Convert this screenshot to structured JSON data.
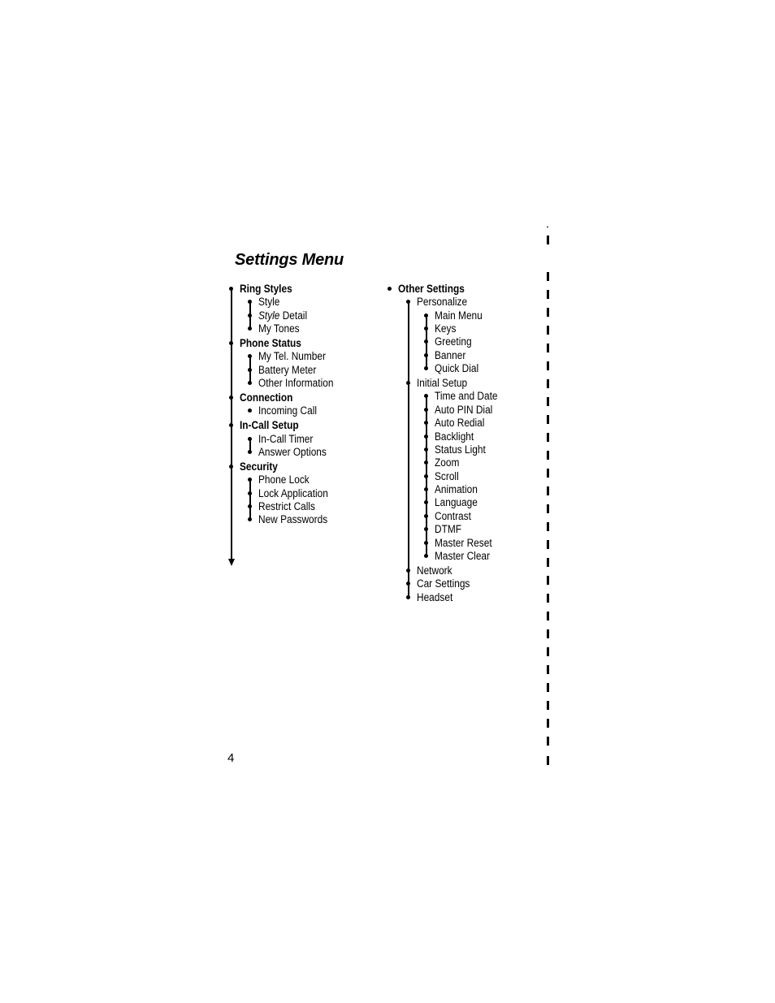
{
  "page": {
    "title": "Settings Menu",
    "page_number": "4"
  },
  "left_column": [
    {
      "label": "Ring Styles",
      "children": [
        {
          "label": "Style"
        },
        {
          "label_italic": "Style",
          "label_rest": " Detail"
        },
        {
          "label": "My Tones"
        }
      ]
    },
    {
      "label": "Phone Status",
      "children": [
        {
          "label": "My Tel. Number"
        },
        {
          "label": "Battery Meter"
        },
        {
          "label": "Other Information"
        }
      ]
    },
    {
      "label": "Connection",
      "children": [
        {
          "label": "Incoming Call"
        }
      ]
    },
    {
      "label": "In-Call Setup",
      "children": [
        {
          "label": "In-Call Timer"
        },
        {
          "label": "Answer Options"
        }
      ]
    },
    {
      "label": "Security",
      "children": [
        {
          "label": "Phone Lock"
        },
        {
          "label": "Lock Application"
        },
        {
          "label": "Restrict Calls"
        },
        {
          "label": "New Passwords"
        }
      ]
    }
  ],
  "right_column": {
    "label": "Other Settings",
    "children": [
      {
        "label": "Personalize",
        "children": [
          {
            "label": "Main Menu"
          },
          {
            "label": "Keys"
          },
          {
            "label": "Greeting"
          },
          {
            "label": "Banner"
          },
          {
            "label": "Quick Dial"
          }
        ]
      },
      {
        "label": "Initial Setup",
        "children": [
          {
            "label": "Time and Date"
          },
          {
            "label": "Auto PIN Dial"
          },
          {
            "label": "Auto Redial"
          },
          {
            "label": "Backlight"
          },
          {
            "label": "Status Light"
          },
          {
            "label": "Zoom"
          },
          {
            "label": "Scroll"
          },
          {
            "label": "Animation"
          },
          {
            "label": "Language"
          },
          {
            "label": "Contrast"
          },
          {
            "label": "DTMF"
          },
          {
            "label": "Master Reset"
          },
          {
            "label": "Master Clear"
          }
        ]
      },
      {
        "label": "Network"
      },
      {
        "label": "Car Settings"
      },
      {
        "label": "Headset"
      }
    ]
  }
}
